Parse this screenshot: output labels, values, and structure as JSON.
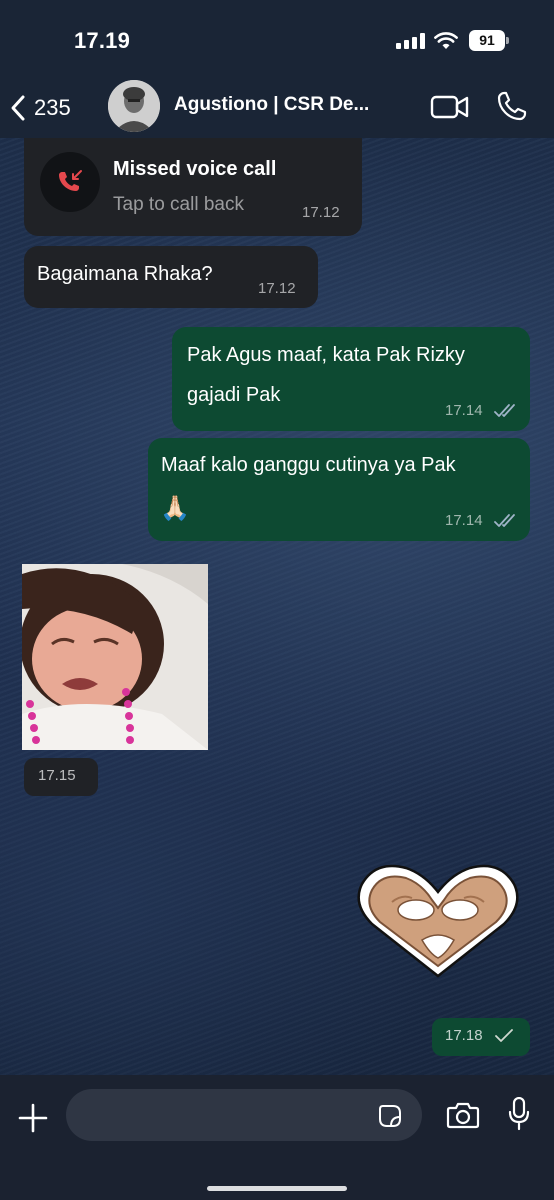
{
  "status_bar": {
    "time": "17.19",
    "battery": "91"
  },
  "header": {
    "back_count": "235",
    "contact_name": "Agustiono | CSR De..."
  },
  "messages": [
    {
      "type": "missed_call",
      "direction": "incoming",
      "title": "Missed voice call",
      "subtitle": "Tap to call back",
      "time": "17.12"
    },
    {
      "type": "text",
      "direction": "incoming",
      "text": "Bagaimana Rhaka?",
      "time": "17.12"
    },
    {
      "type": "text",
      "direction": "outgoing",
      "lines": [
        "Pak Agus maaf, kata Pak Rizky",
        "gajadi Pak"
      ],
      "time": "17.14",
      "status": "read"
    },
    {
      "type": "text",
      "direction": "outgoing",
      "lines": [
        "Maaf kalo ganggu cutinya ya Pak",
        "🙏🏻"
      ],
      "time": "17.14",
      "status": "read"
    },
    {
      "type": "sticker",
      "direction": "incoming",
      "time": "17.15"
    },
    {
      "type": "sticker",
      "direction": "outgoing",
      "time": "17.18",
      "status": "delivered"
    }
  ],
  "input_bar": {
    "placeholder": ""
  },
  "icons": {
    "back": "chevron-left-icon",
    "video": "video-call-icon",
    "call": "phone-icon",
    "missed_call": "missed-call-icon",
    "plus": "plus-icon",
    "sticker": "sticker-icon",
    "camera": "camera-icon",
    "mic": "microphone-icon"
  },
  "colors": {
    "incoming_bubble": "#202226",
    "outgoing_bubble": "#0d4a32",
    "missed_call_red": "#e5484d",
    "read_check": "#9fb4c8"
  }
}
